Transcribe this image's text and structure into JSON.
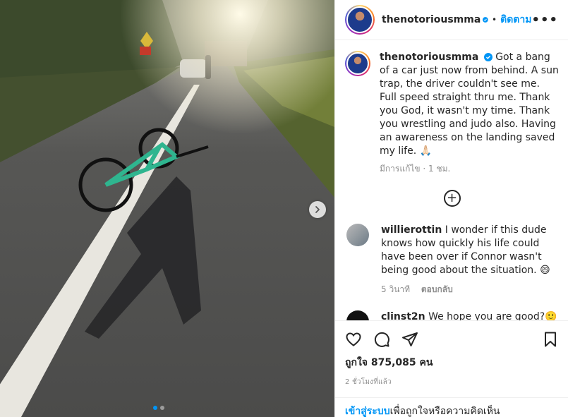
{
  "post": {
    "username": "thenotoriousmma",
    "follow_label": "ติดตาม",
    "separator": "•",
    "more_label": "•••",
    "caption": "Got a bang of a car just now from behind. A sun trap, the driver couldn't see me. Full speed straight thru me. Thank you God, it wasn't my time. Thank you wrestling and judo also. Having an awareness on the landing saved my life. 🙏🏻",
    "caption_meta": "มีการแก้ไข · 1 ชม.",
    "load_more_label": "+",
    "likes_label": "ถูกใจ 875,085 คน",
    "posted_time": "2 ชั่วโมงที่แล้ว"
  },
  "comments": [
    {
      "username": "willierottin",
      "text": "I wonder if this dude knows how quickly his life could have been over if Connor wasn't being good about the situation. 😄",
      "time": "5 วินาที",
      "reply_label": "ตอบกลับ"
    },
    {
      "username": "clinst2n",
      "text": "We hope you are good?🙂"
    }
  ],
  "login_bar": {
    "link": "เข้าสู่ระบบ",
    "text": "เพื่อถูกใจหรือความคิดเห็น"
  },
  "colors": {
    "accent": "#0095f6",
    "text": "#262626",
    "muted": "#8e8e8e",
    "bike": "#2fb58f"
  },
  "icons": [
    "verified-badge-icon",
    "more-options-icon",
    "add-circle-icon",
    "heart-icon",
    "comment-icon",
    "share-icon",
    "bookmark-icon",
    "next-arrow-icon"
  ]
}
